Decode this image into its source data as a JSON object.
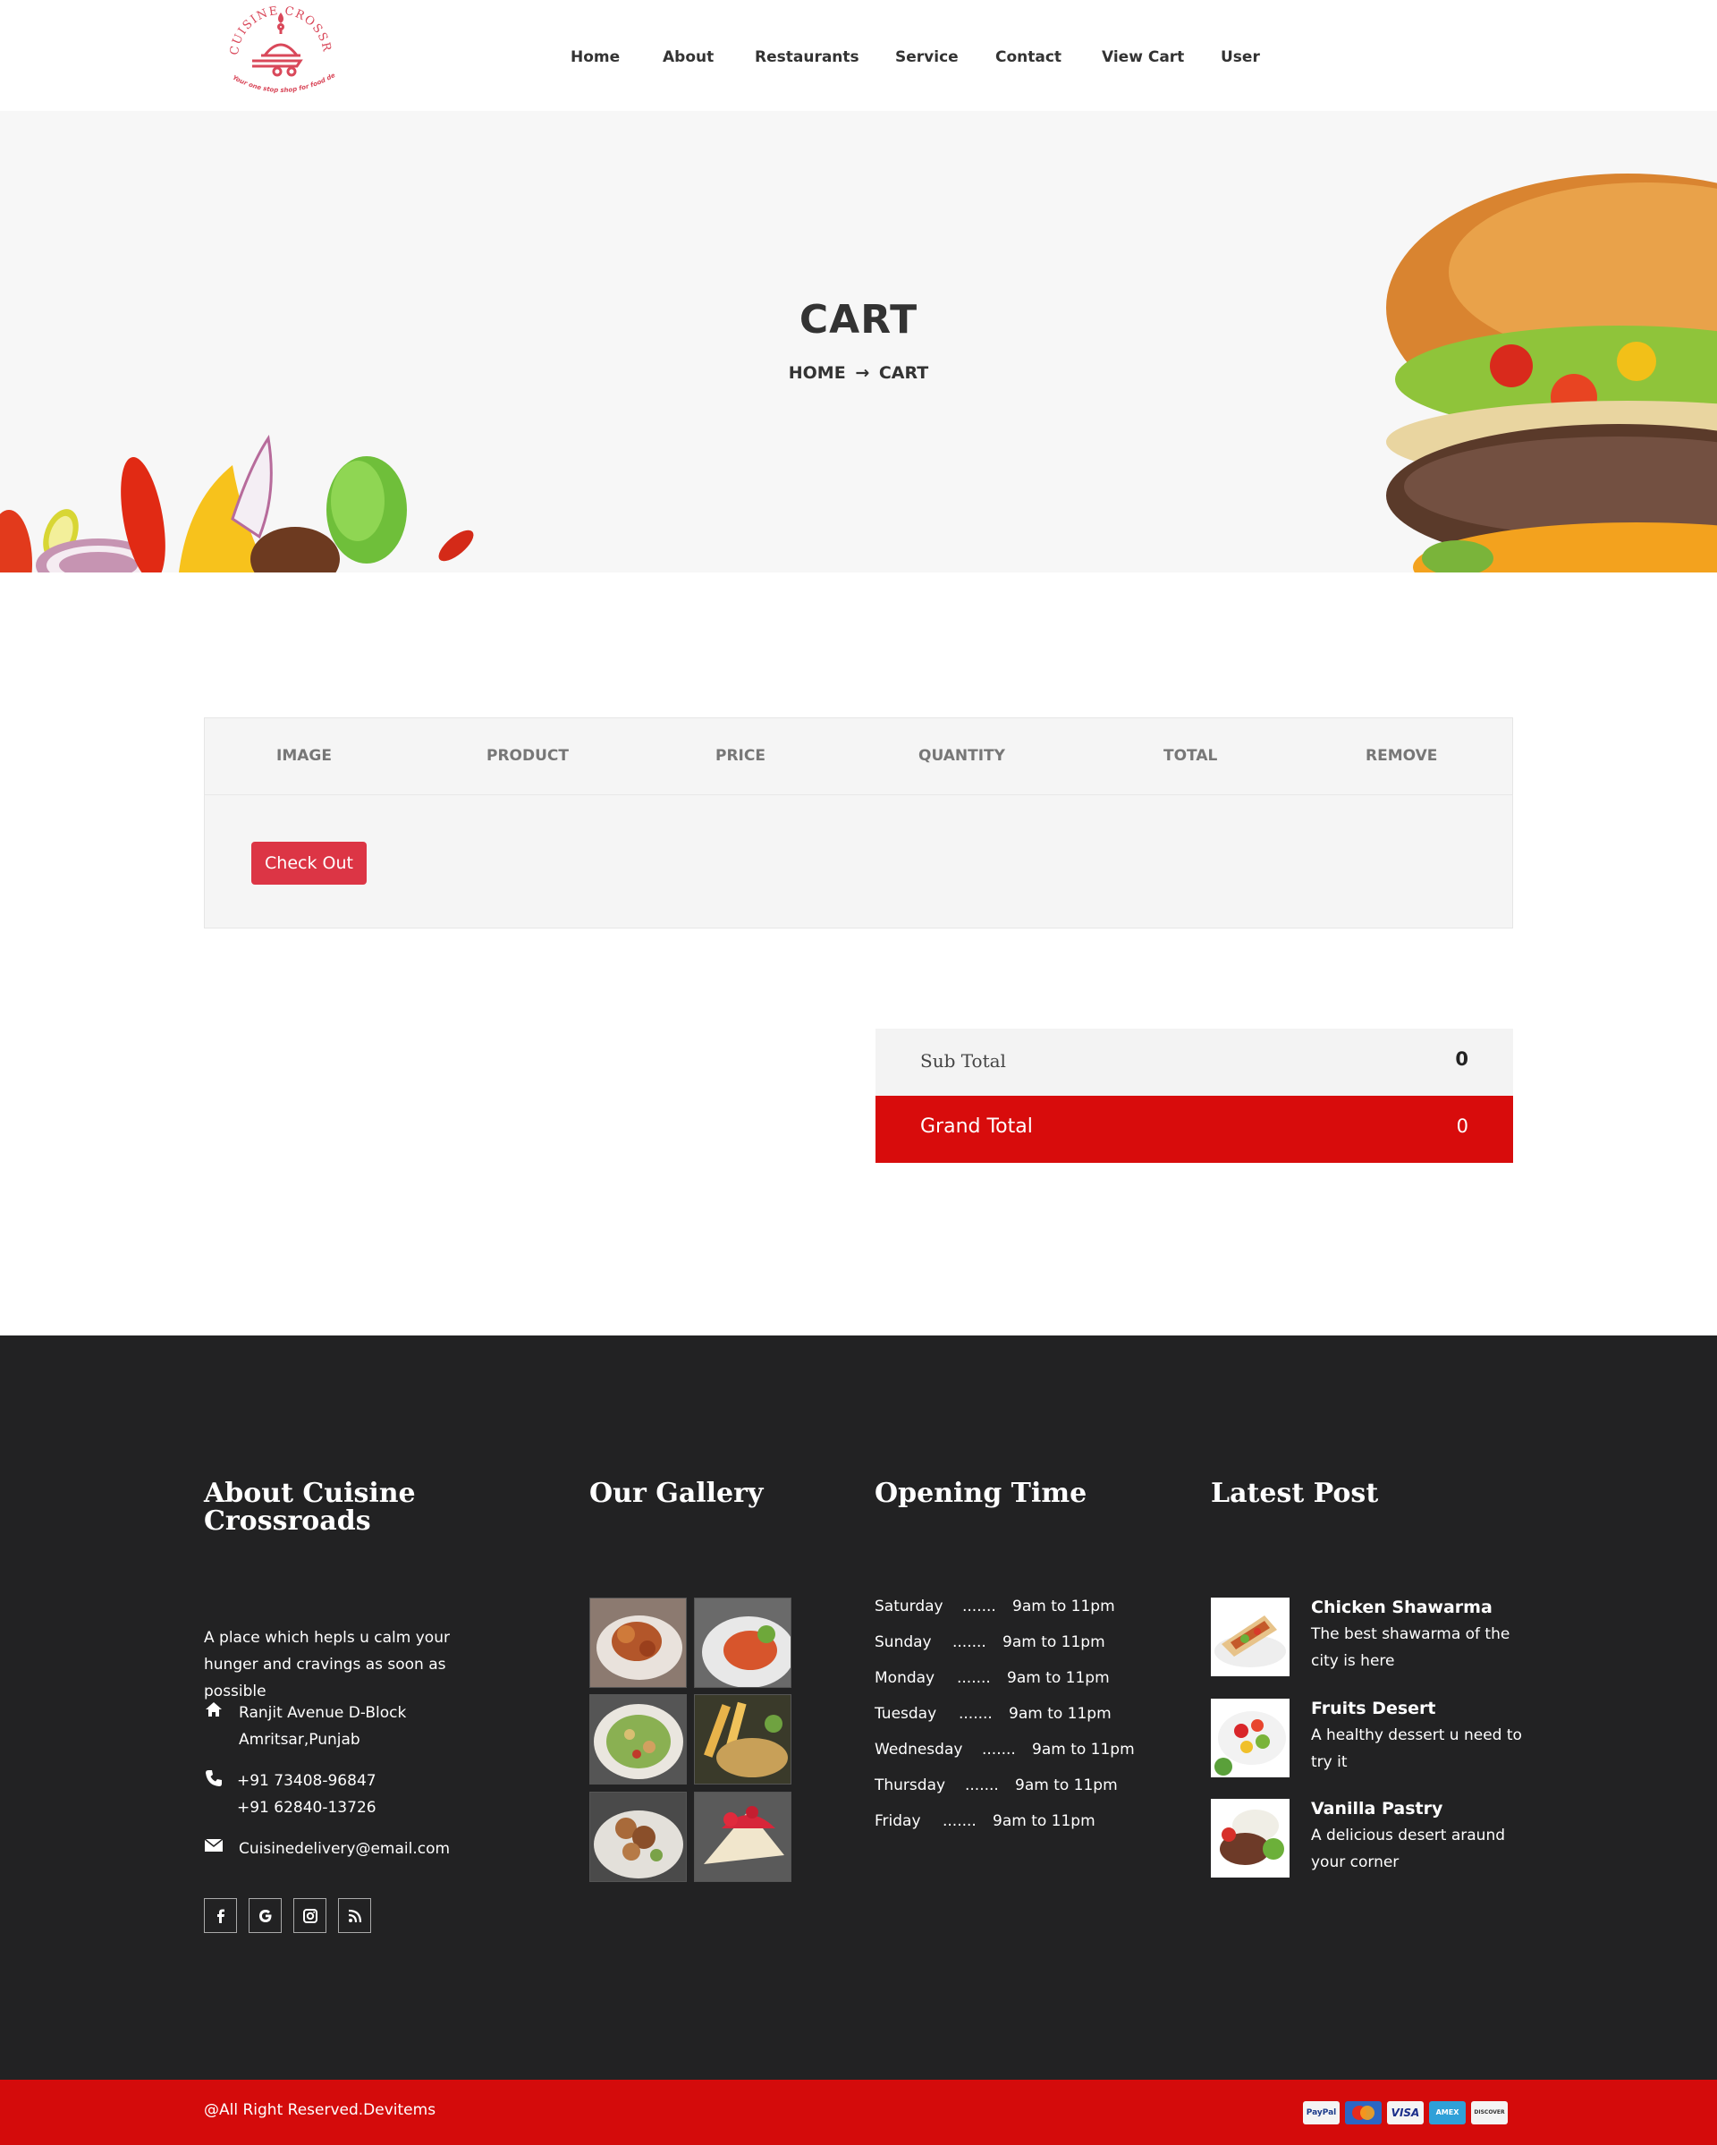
{
  "logo": {
    "brand": "CUISINE CROSSROADS",
    "tagline": "Your one stop shop for food delivery"
  },
  "nav": [
    "Home",
    "About",
    "Restaurants",
    "Service",
    "Contact",
    "View Cart",
    "User"
  ],
  "banner": {
    "title": "CART",
    "crumb_home": "HOME",
    "crumb_arrow": "→",
    "crumb_current": "CART"
  },
  "cart": {
    "columns": [
      "IMAGE",
      "PRODUCT",
      "PRICE",
      "QUANTITY",
      "TOTAL",
      "REMOVE"
    ],
    "checkout_label": "Check Out"
  },
  "totals": {
    "sub_label": "Sub Total",
    "sub_value": "0",
    "grand_label": "Grand Total",
    "grand_value": "0"
  },
  "footer": {
    "about": {
      "title": "About Cuisine Crossroads",
      "description": "A place which hepls u calm your hunger and cravings as soon as possible",
      "address_line1": "Ranjit Avenue D-Block",
      "address_line2": "Amritsar,Punjab",
      "phone1": "+91 73408-96847",
      "phone2": "+91 62840-13726",
      "email": "Cuisinedelivery@email.com",
      "social": [
        "facebook-icon",
        "google-icon",
        "instagram-icon",
        "rss-icon"
      ]
    },
    "gallery": {
      "title": "Our Gallery"
    },
    "hours": {
      "title": "Opening Time",
      "rows": [
        {
          "day": "Saturday",
          "dots": ".......",
          "time": "9am to 11pm"
        },
        {
          "day": "Sunday",
          "dots": ".......",
          "time": "9am to 11pm"
        },
        {
          "day": "Monday",
          "dots": ".......",
          "time": "9am to 11pm"
        },
        {
          "day": "Tuesday",
          "dots": ".......",
          "time": "9am to 11pm"
        },
        {
          "day": "Wednesday",
          "dots": ".......",
          "time": "9am to 11pm"
        },
        {
          "day": "Thursday",
          "dots": ".......",
          "time": "9am to 11pm"
        },
        {
          "day": "Friday",
          "dots": ".......",
          "time": "9am to 11pm"
        }
      ]
    },
    "posts": {
      "title": "Latest Post",
      "items": [
        {
          "title": "Chicken Shawarma",
          "desc": "The best shawarma of the city is here"
        },
        {
          "title": "Fruits Desert",
          "desc": "A healthy dessert u need to try it"
        },
        {
          "title": "Vanilla Pastry",
          "desc": "A delicious desert araund your corner"
        }
      ]
    }
  },
  "bottom": {
    "copyright": "@All Right Reserved.Devitems",
    "payments": [
      "PayPal",
      "MC",
      "VISA",
      "AMEX",
      "DISCOVER"
    ]
  },
  "colors": {
    "accent": "#d80c0c",
    "button": "#dc3545",
    "footer_bg": "#222223",
    "banner_bg": "#f7f7f7"
  }
}
